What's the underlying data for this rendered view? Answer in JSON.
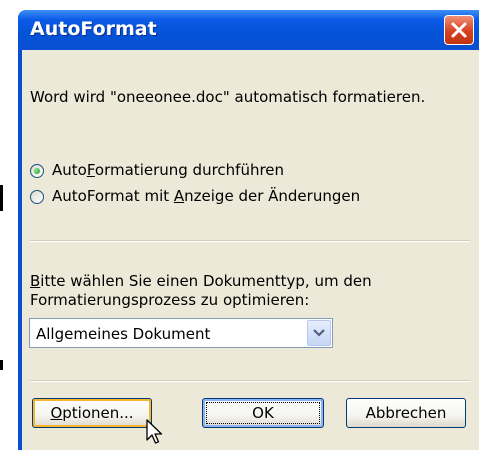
{
  "dialog": {
    "title": "AutoFormat",
    "message": "Word wird \"oneeonee.doc\" automatisch formatieren.",
    "options": [
      {
        "pre": "Auto",
        "accel": "F",
        "post": "ormatierung durchführen",
        "selected": true
      },
      {
        "pre": "AutoFormat mit ",
        "accel": "A",
        "post": "nzeige der Änderungen",
        "selected": false
      }
    ],
    "doctype_prompt_line1_accel": "B",
    "doctype_prompt_line1_rest": "itte wählen Sie einen Dokumenttyp, um den",
    "doctype_prompt_line2": "Formatierungsprozess zu optimieren:",
    "doctype_selected": "Allgemeines Dokument",
    "buttons": {
      "options_accel": "O",
      "options_rest": "ptionen...",
      "ok": "OK",
      "cancel": "Abbrechen"
    }
  },
  "icons": {
    "close": "close-icon",
    "dropdown": "chevron-down-icon",
    "cursor": "mouse-pointer-icon"
  },
  "colors": {
    "titlebar": "#0353d8",
    "client": "#ece9d8",
    "close": "#d6411e",
    "radio_dot": "#21a121"
  }
}
